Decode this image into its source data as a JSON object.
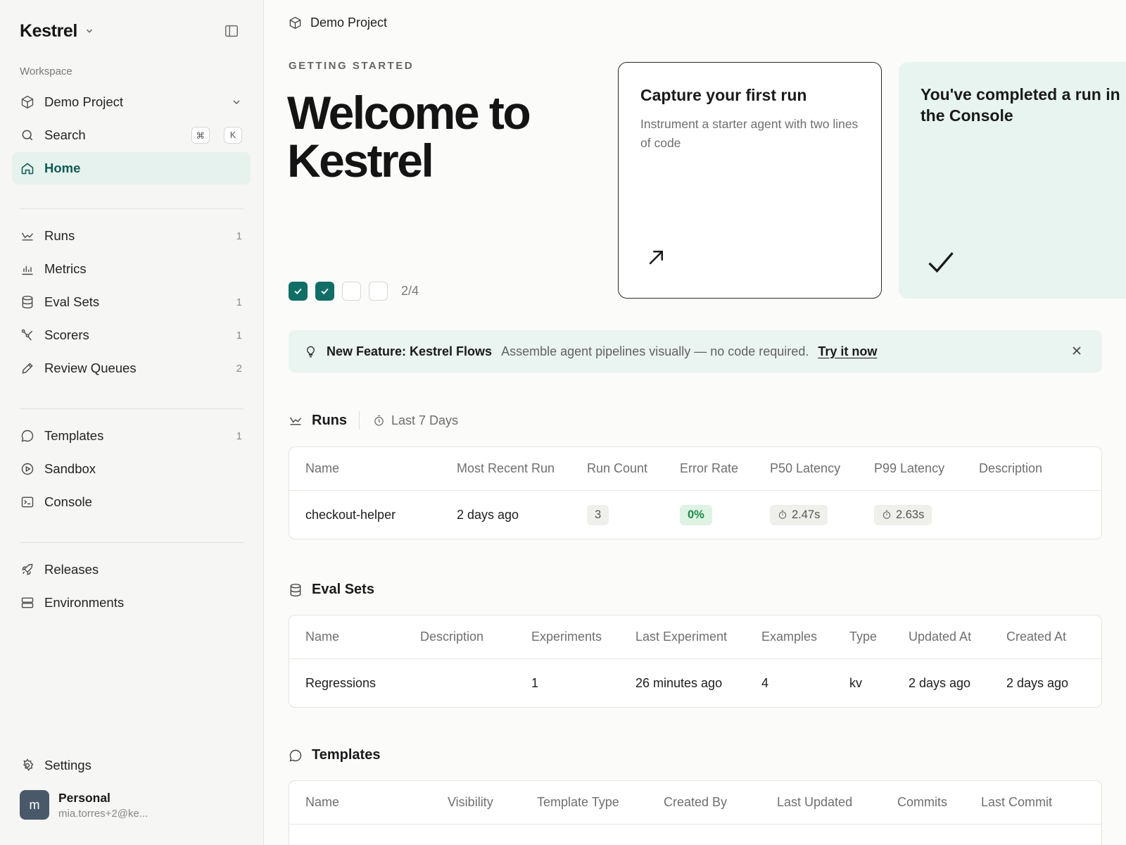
{
  "sidebar": {
    "brand": "Kestrel",
    "workspace_label": "Workspace",
    "project": "Demo Project",
    "search": {
      "label": "Search",
      "keys": [
        "⌘",
        "K"
      ]
    },
    "home": "Home",
    "group1": [
      {
        "label": "Runs",
        "count": "1",
        "icon": "runs-icon"
      },
      {
        "label": "Metrics",
        "count": "",
        "icon": "bar-chart-icon"
      },
      {
        "label": "Eval Sets",
        "count": "1",
        "icon": "database-icon"
      },
      {
        "label": "Scorers",
        "count": "1",
        "icon": "scorer-icon"
      },
      {
        "label": "Review Queues",
        "count": "2",
        "icon": "pencil-icon"
      }
    ],
    "group2": [
      {
        "label": "Templates",
        "count": "1",
        "icon": "chat-bubble-icon"
      },
      {
        "label": "Sandbox",
        "count": "",
        "icon": "play-icon"
      },
      {
        "label": "Console",
        "count": "",
        "icon": "terminal-icon"
      }
    ],
    "group3": [
      {
        "label": "Releases",
        "icon": "rocket-icon"
      },
      {
        "label": "Environments",
        "icon": "server-icon"
      }
    ],
    "settings": "Settings",
    "profile": {
      "initial": "m",
      "name": "Personal",
      "email": "mia.torres+2@ke..."
    }
  },
  "header": {
    "breadcrumb": "Demo Project"
  },
  "hero": {
    "eyebrow": "GETTING STARTED",
    "title": "Welcome to Kestrel",
    "progress": {
      "completed": 2,
      "total": 4,
      "label": "2/4"
    }
  },
  "cards": [
    {
      "title": "Capture your first run",
      "description": "Instrument a starter agent with two lines of code",
      "icon": "arrow-up-right-icon"
    },
    {
      "title": "You've completed a run in the Console",
      "description": "",
      "icon": "checkmark-icon"
    }
  ],
  "banner": {
    "title": "New Feature: Kestrel Flows",
    "description": "Assemble agent pipelines visually — no code required.",
    "link": "Try it now"
  },
  "runs_section": {
    "title": "Runs",
    "filter": "Last 7 Days",
    "columns": [
      "Name",
      "Most Recent Run",
      "Run Count",
      "Error Rate",
      "P50 Latency",
      "P99 Latency",
      "Description"
    ],
    "rows": [
      {
        "name": "checkout-helper",
        "recent": "2 days ago",
        "count": "3",
        "error_rate": "0%",
        "p50": "2.47s",
        "p99": "2.63s",
        "description": ""
      }
    ]
  },
  "eval_section": {
    "title": "Eval Sets",
    "columns": [
      "Name",
      "Description",
      "Experiments",
      "Last Experiment",
      "Examples",
      "Type",
      "Updated At",
      "Created At"
    ],
    "rows": [
      {
        "name": "Regressions",
        "description": "",
        "experiments": "1",
        "last_experiment": "26 minutes ago",
        "examples": "4",
        "type": "kv",
        "updated": "2 days ago",
        "created": "2 days ago"
      }
    ]
  },
  "templates_section": {
    "title": "Templates",
    "columns": [
      "Name",
      "Visibility",
      "Template Type",
      "Created By",
      "Last Updated",
      "Commits",
      "Last Commit"
    ]
  },
  "colors": {
    "accent": "#106e66",
    "active_bg": "#e6f2ee",
    "banner_bg": "#eaf4f0",
    "success": "#1e8a4a"
  }
}
